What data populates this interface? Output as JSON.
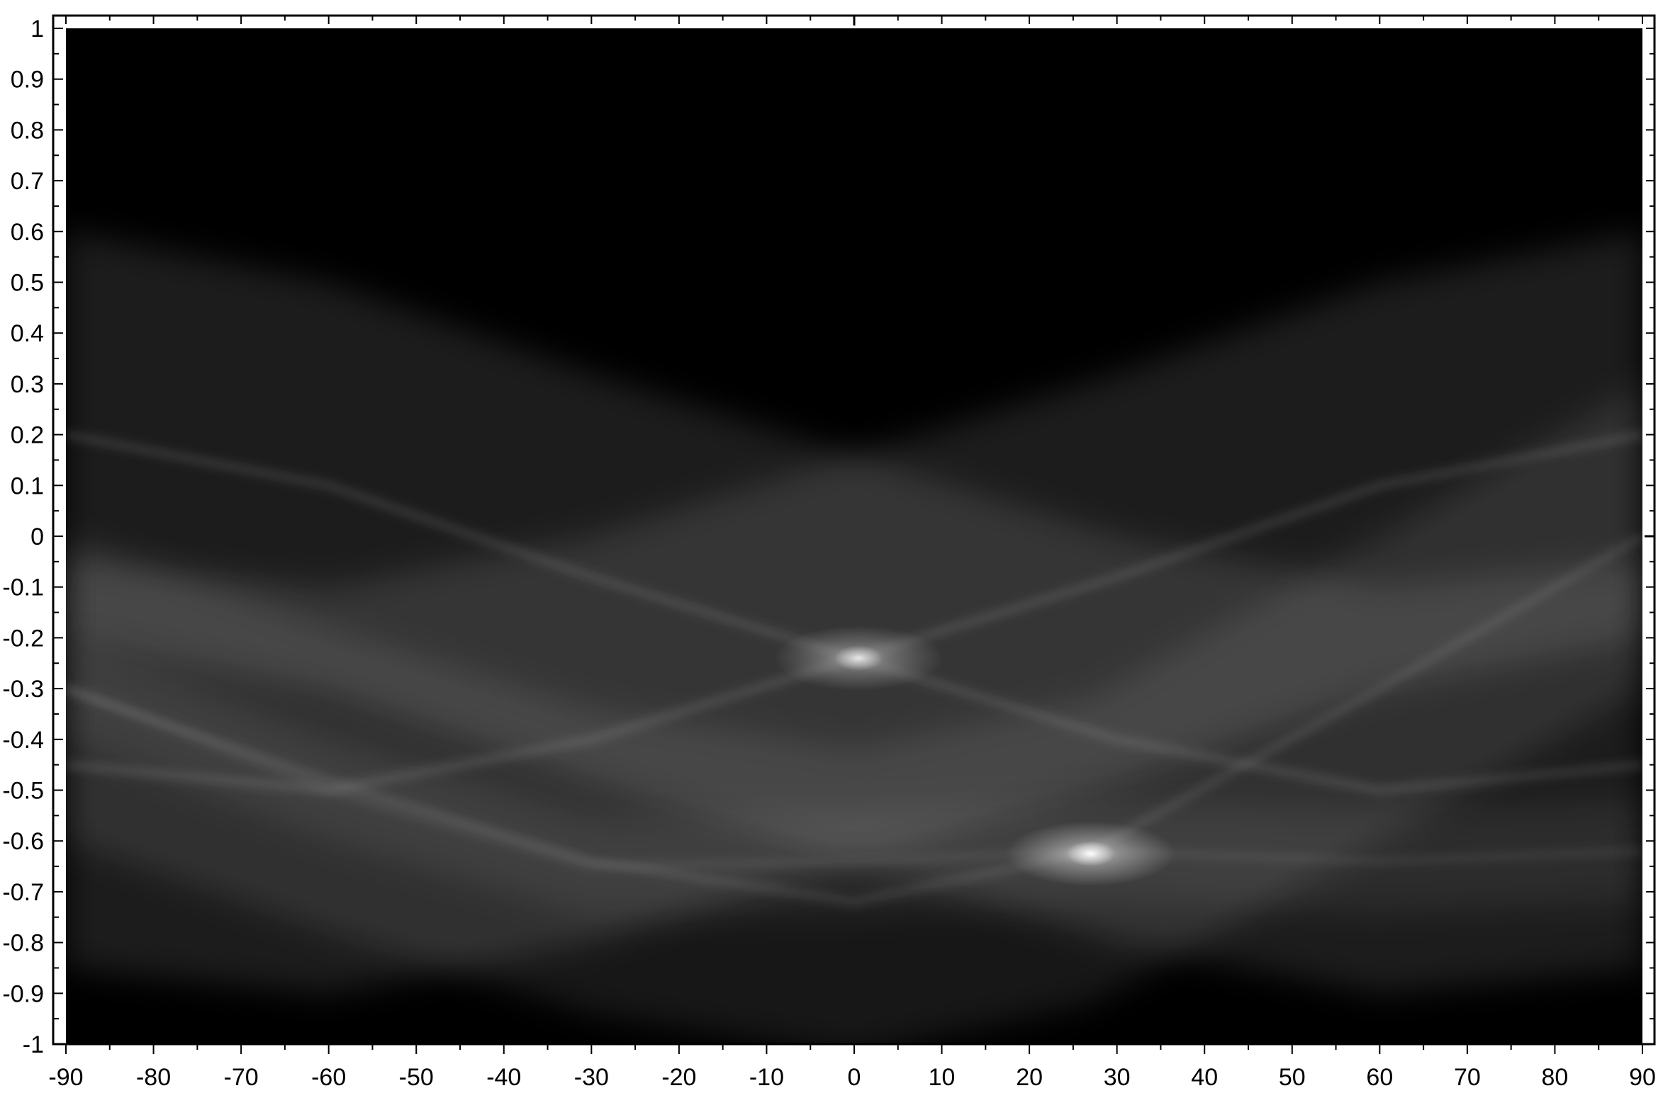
{
  "chart_data": {
    "type": "heatmap",
    "title": "",
    "xlabel": "",
    "ylabel": "",
    "xlim": [
      -90,
      90
    ],
    "ylim": [
      -1,
      1
    ],
    "x_ticks": [
      "-90",
      "-80",
      "-70",
      "-60",
      "-50",
      "-40",
      "-30",
      "-20",
      "-10",
      "0",
      "10",
      "20",
      "30",
      "40",
      "50",
      "60",
      "70",
      "80",
      "90"
    ],
    "y_ticks": [
      "1",
      "0.9",
      "0.8",
      "0.7",
      "0.6",
      "0.5",
      "0.4",
      "0.3",
      "0.2",
      "0.1",
      "0",
      "-0.1",
      "-0.2",
      "-0.3",
      "-0.4",
      "-0.5",
      "-0.6",
      "-0.7",
      "-0.8",
      "-0.9",
      "-1"
    ],
    "colormap": "grayscale",
    "colors": {
      "background": "#000000",
      "frame": "#000000",
      "band": "#ffffff"
    },
    "bands": [
      {
        "name": "",
        "center": [
          [
            -90,
            0.2
          ],
          [
            -60,
            0.1
          ],
          [
            -30,
            -0.08
          ],
          [
            0,
            -0.24
          ],
          [
            30,
            -0.4
          ],
          [
            60,
            -0.5
          ],
          [
            90,
            -0.45
          ]
        ],
        "half_width": 0.4,
        "intensity": 0.11
      },
      {
        "name": "",
        "center": [
          [
            -90,
            -0.45
          ],
          [
            -60,
            -0.5
          ],
          [
            -30,
            -0.4
          ],
          [
            0,
            -0.24
          ],
          [
            30,
            -0.08
          ],
          [
            60,
            0.1
          ],
          [
            90,
            0.2
          ]
        ],
        "half_width": 0.4,
        "intensity": 0.11
      },
      {
        "name": "",
        "center": [
          [
            -90,
            -0.3
          ],
          [
            -60,
            -0.48
          ],
          [
            -30,
            -0.64
          ],
          [
            0,
            -0.72
          ],
          [
            27,
            -0.62
          ],
          [
            60,
            -0.3
          ],
          [
            90,
            0.0
          ]
        ],
        "half_width": 0.3,
        "intensity": 0.09
      },
      {
        "name": "",
        "center": [
          [
            -90,
            -0.3
          ],
          [
            -60,
            -0.5
          ],
          [
            -30,
            -0.65
          ],
          [
            0,
            -0.64
          ],
          [
            27,
            -0.62
          ],
          [
            60,
            -0.64
          ],
          [
            90,
            -0.62
          ]
        ],
        "half_width": 0.1,
        "intensity": 0.07
      }
    ],
    "hotspots": [
      {
        "x": 0.5,
        "y": -0.24,
        "peak": 0.72
      },
      {
        "x": 27,
        "y": -0.625,
        "peak": 0.95
      }
    ]
  }
}
